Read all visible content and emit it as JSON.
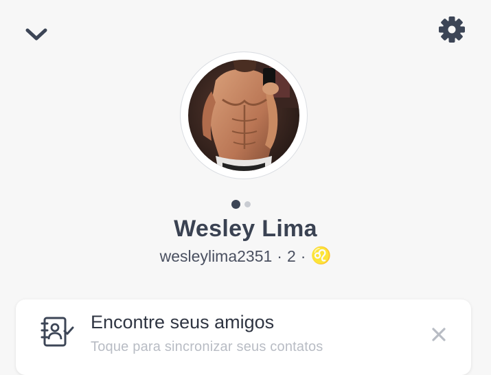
{
  "header": {
    "collapse_icon": "chevron-down-icon",
    "settings_icon": "gear-icon"
  },
  "profile": {
    "display_name": "Wesley Lima",
    "username": "wesleylima2351",
    "score": "2",
    "zodiac": "♌",
    "separator": "·",
    "page_count": 2,
    "active_page": 1
  },
  "find_friends_card": {
    "title": "Encontre seus amigos",
    "subtitle": "Toque para sincronizar seus contatos",
    "icon": "contacts-book-icon",
    "close_icon": "close-icon"
  },
  "colors": {
    "background": "#f7f7f7",
    "text_primary": "#3a4252",
    "text_secondary": "#b8bcc4",
    "icon": "#3c4556"
  }
}
